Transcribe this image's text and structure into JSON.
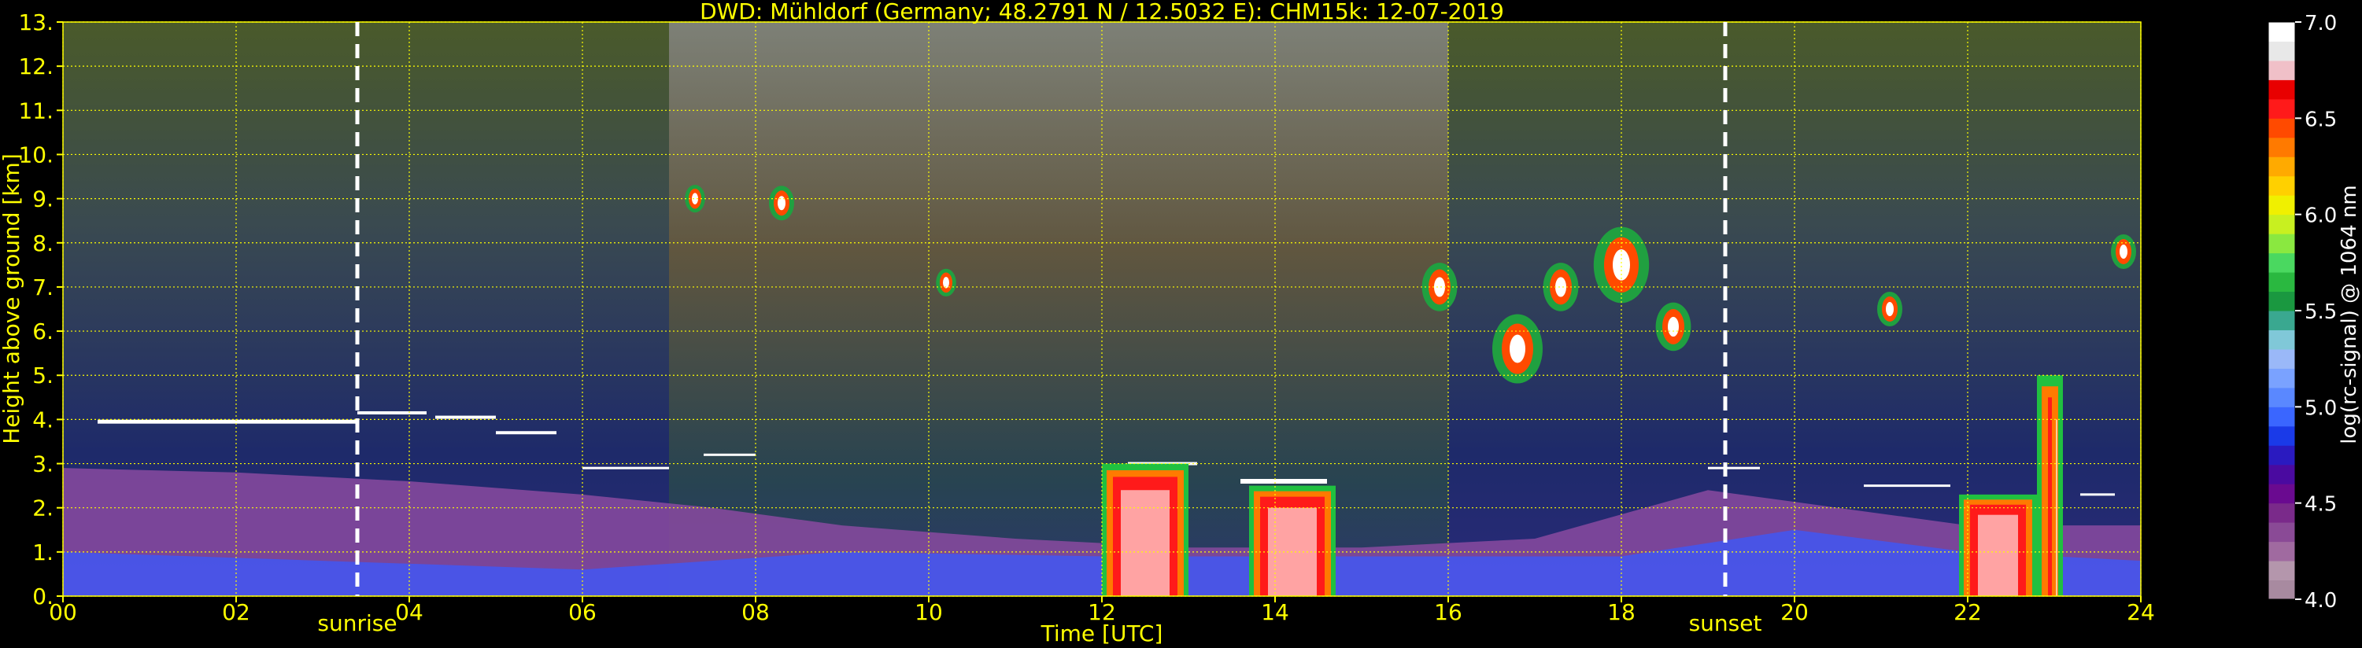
{
  "chart_data": {
    "type": "heatmap",
    "title": "DWD: Mühldorf (Germany; 48.2791 N / 12.5032 E):    CHM15k: 12-07-2019",
    "xlabel": "Time [UTC]",
    "ylabel": "Height above ground [km]",
    "xlim": [
      0,
      24
    ],
    "ylim": [
      0,
      13
    ],
    "x_ticks": [
      "00",
      "02",
      "04",
      "06",
      "08",
      "10",
      "12",
      "14",
      "16",
      "18",
      "20",
      "22",
      "24"
    ],
    "y_ticks": [
      "0.",
      "1.",
      "2.",
      "3.",
      "4.",
      "5.",
      "6.",
      "7.",
      "8.",
      "9.",
      "10.",
      "11.",
      "12.",
      "13."
    ],
    "grid": true,
    "events": [
      {
        "label": "sunrise",
        "time": 3.4
      },
      {
        "label": "sunset",
        "time": 19.2
      }
    ],
    "colorbar": {
      "label": "log(rc-signal) @ 1064 nm",
      "range": [
        4.0,
        7.0
      ],
      "ticks": [
        "4.0",
        "4.5",
        "5.0",
        "5.5",
        "6.0",
        "6.5",
        "7.0"
      ],
      "colors": [
        "#a88aa0",
        "#b496ac",
        "#a06aa0",
        "#8a4a96",
        "#7a2a8a",
        "#6a0a90",
        "#4a0aa0",
        "#2a1ac0",
        "#1a3ae8",
        "#3a66ff",
        "#5a88ff",
        "#7aa2ff",
        "#9ab8f8",
        "#80c8d8",
        "#3aa890",
        "#1a9840",
        "#2ab840",
        "#4ad860",
        "#8ae840",
        "#c8f020",
        "#f0f000",
        "#ffd000",
        "#ffaa00",
        "#ff7a00",
        "#ff4a00",
        "#ff1a1a",
        "#e80000",
        "#f0c0c8",
        "#e8e8e8",
        "#ffffff"
      ]
    }
  }
}
